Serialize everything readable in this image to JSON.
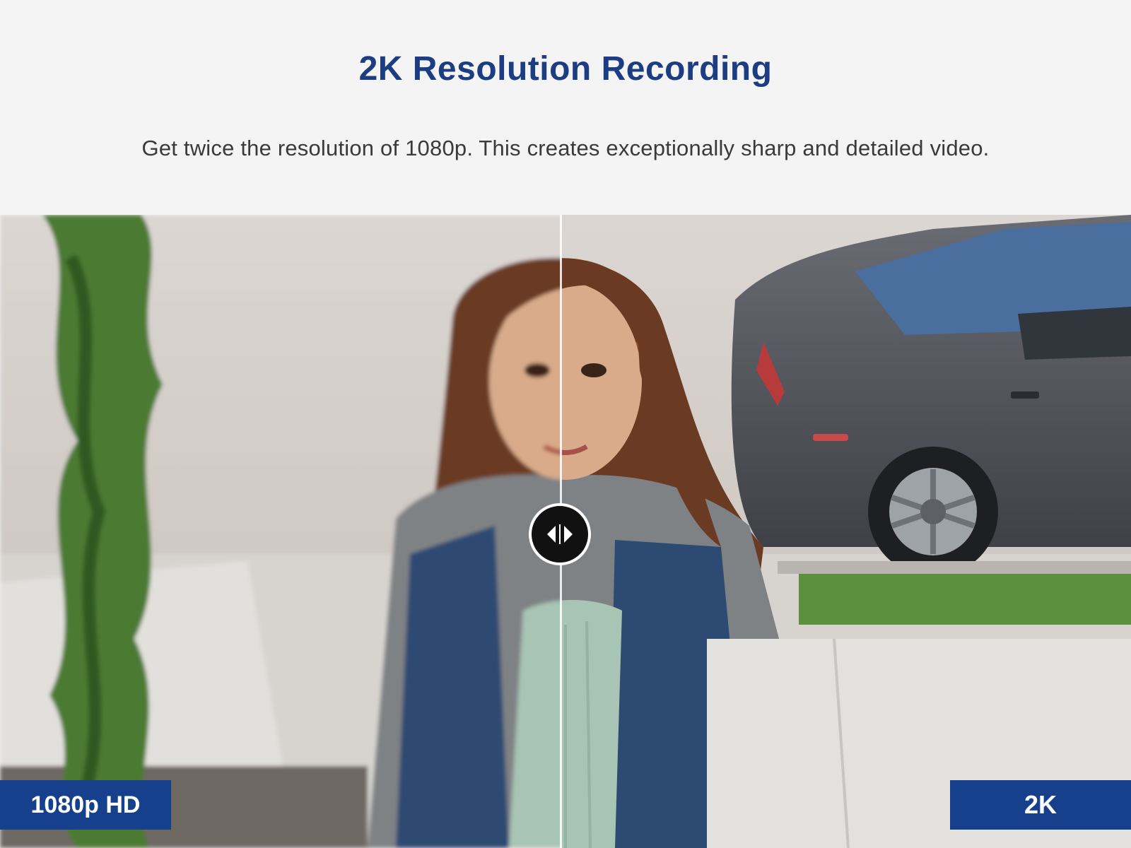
{
  "header": {
    "title": "2K Resolution Recording",
    "subtitle": "Get twice the resolution of 1080p. This creates exceptionally sharp and detailed video."
  },
  "comparison": {
    "left_label": "1080p HD",
    "right_label": "2K",
    "handle_icon": "left-right-arrows-icon"
  },
  "colors": {
    "title": "#1c3d82",
    "label_bg": "#163f8c",
    "label_text": "#ffffff"
  }
}
